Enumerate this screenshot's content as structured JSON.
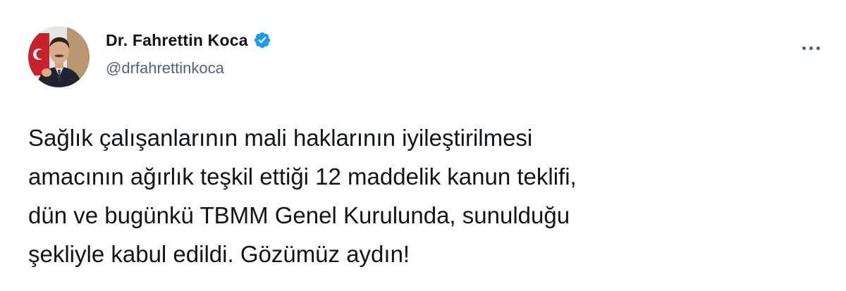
{
  "author": {
    "display_name": "Dr. Fahrettin Koca",
    "handle": "@drfahrettinkoca",
    "verified": true
  },
  "icons": {
    "verified": "verified-badge-icon",
    "more": "more-options-icon"
  },
  "colors": {
    "verified_blue": "#1d9bf0",
    "text_primary": "#0f1419",
    "text_secondary": "#536471"
  },
  "tweet": {
    "lines": [
      "Sağlık çalışanlarının mali haklarının iyileştirilmesi",
      "amacının ağırlık teşkil ettiği 12 maddelik kanun teklifi,",
      "dün ve bugünkü TBMM Genel Kurulunda, sunulduğu",
      "şekliyle kabul edildi. Gözümüz aydın!"
    ]
  }
}
